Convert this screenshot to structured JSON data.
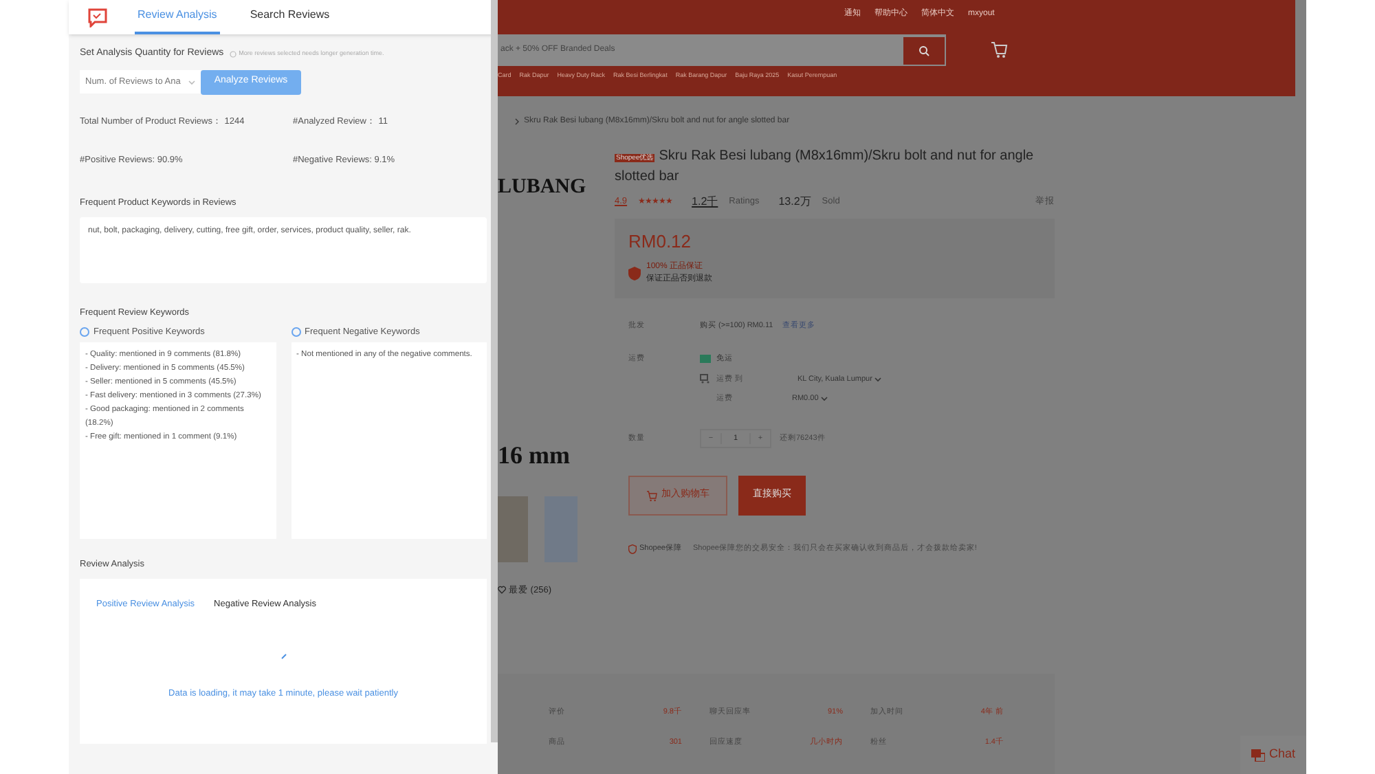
{
  "panel": {
    "tabs": [
      {
        "label": "Review Analysis",
        "selected": true
      },
      {
        "label": "Search Reviews",
        "selected": false
      }
    ],
    "quantity": {
      "label": "Set Analysis Quantity for Reviews",
      "hint": "More reviews selected needs longer generation time.",
      "select_placeholder": "Num. of Reviews to Ana",
      "button": "Analyze Reviews"
    },
    "stats": [
      {
        "label": "Total Number of Product Reviews：",
        "value": "1244"
      },
      {
        "label": "#Analyzed Review：",
        "value": "11"
      },
      {
        "label": "#Positive Reviews:",
        "value": "90.9%"
      },
      {
        "label": "#Negative Reviews:",
        "value": "9.1%"
      }
    ],
    "product_keywords": {
      "title": "Frequent Product Keywords in Reviews",
      "text": "nut, bolt, packaging, delivery, cutting, free gift, order, services, product quality, seller, rak."
    },
    "review_keywords": {
      "title": "Frequent Review Keywords",
      "columns": [
        {
          "title": "Frequent Positive Keywords",
          "lines": [
            "- Quality: mentioned in 9 comments (81.8%)",
            "- Delivery: mentioned in 5 comments (45.5%)",
            "- Seller: mentioned in 5 comments (45.5%)",
            "- Fast delivery: mentioned in 3 comments (27.3%)",
            "- Good packaging: mentioned in 2 comments (18.2%)",
            "- Free gift: mentioned in 1 comment (9.1%)"
          ]
        },
        {
          "title": "Frequent Negative Keywords",
          "lines": [
            "- Not mentioned in any of the negative comments."
          ]
        }
      ]
    },
    "analysis": {
      "title": "Review Analysis",
      "tabs": [
        {
          "label": "Positive Review Analysis",
          "selected": true
        },
        {
          "label": "Negative Review Analysis",
          "selected": false
        }
      ],
      "loading": "Data is loading, it may take 1 minute, please wait patiently"
    }
  },
  "page": {
    "top_links": [
      "通知",
      "帮助中心",
      "简体中文",
      "mxyout"
    ],
    "search_placeholder": "ack + 50% OFF Branded Deals",
    "suggestions": [
      "Card",
      "Rak Dapur",
      "Heavy Duty Rack",
      "Rak Besi Berlingkat",
      "Rak Barang Dapur",
      "Baju Raya 2025",
      "Kasut Perempuan"
    ],
    "breadcrumb": "Skru Rak Besi lubang (M8x16mm)/Skru bolt and nut for angle slotted bar",
    "image_texts": [
      "LUBANG",
      "16 mm"
    ],
    "favorites": "最爱 (256)",
    "badge": "Shopee优选",
    "title": "Skru Rak Besi lubang (M8x16mm)/Skru bolt and nut for angle slotted bar",
    "rating": "4.9",
    "stars": 5,
    "ratings_count": "1.2千",
    "ratings_label": "Ratings",
    "sold_count": "13.2万",
    "sold_label": "Sold",
    "report": "举报",
    "price": "RM0.12",
    "guarantee": "100% 正品保证",
    "guarantee_sub": "保证正品否则退款",
    "rows": [
      {
        "label": "批发",
        "value": "购买 (>=100) RM0.11",
        "link": "查看更多"
      }
    ],
    "shipping_label": "运费",
    "free_shipping": "免运",
    "ship_to_label": "运费 到",
    "ship_to": "KL City, Kuala Lumpur",
    "fee_label": "运费",
    "fee": "RM0.00",
    "qty_label": "数量",
    "qty_minus": "−",
    "qty": "1",
    "qty_plus": "+",
    "stock": "还剩76243件",
    "add_cart": "加入购物车",
    "buy_now": "直接购买",
    "assurance": "Shopee保障",
    "assurance_text": "Shopee保障您的交易安全：我们只会在买家确认收到商品后，才会拨款给卖家!",
    "shop_stats": [
      {
        "label": "评价",
        "value": "9.8千"
      },
      {
        "label": "聊天回应率",
        "value": "91%"
      },
      {
        "label": "加入时间",
        "value": "4年 前"
      },
      {
        "label": "商品",
        "value": "301"
      },
      {
        "label": "回应速度",
        "value": "几小时内"
      },
      {
        "label": "粉丝",
        "value": "1.4千"
      }
    ],
    "chat": "Chat"
  }
}
